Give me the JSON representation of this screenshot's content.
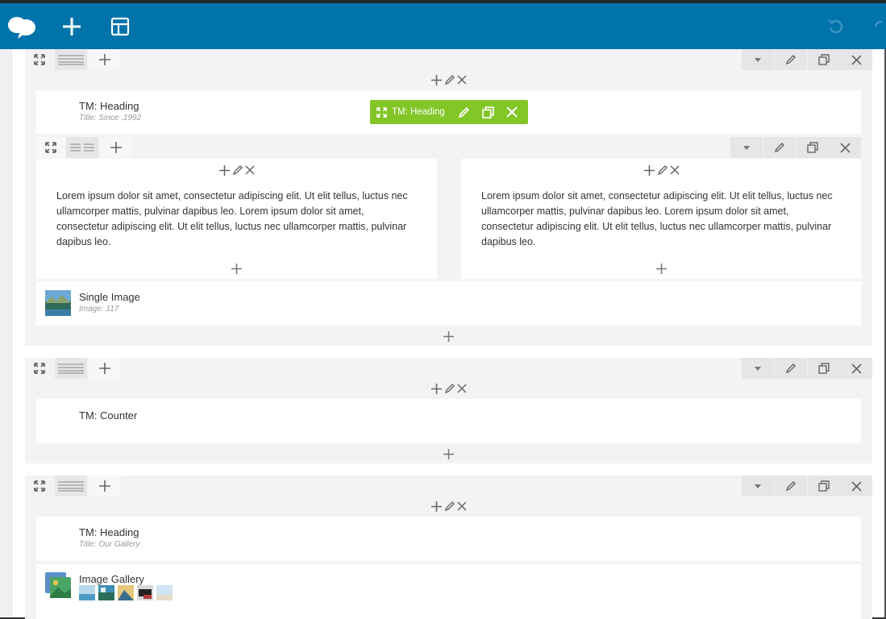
{
  "toolbar": {
    "icons": [
      "elementor-logo-icon",
      "add-element-icon",
      "templates-icon",
      "undo-icon",
      "redo-icon"
    ]
  },
  "rows": [
    {
      "widgets": [
        {
          "title": "TM: Heading",
          "subtitle": "Title: Since .1992"
        },
        {
          "title": "Single Image",
          "subtitle": "Image: 117"
        }
      ],
      "inner_columns": [
        {
          "text": "Lorem ipsum dolor sit amet, consectetur adipiscing elit. Ut elit tellus, luctus nec ullamcorper mattis, pulvinar dapibus leo. Lorem ipsum dolor sit amet, consectetur adipiscing elit. Ut elit tellus, luctus nec ullamcorper mattis, pulvinar dapibus leo."
        },
        {
          "text": "Lorem ipsum dolor sit amet, consectetur adipiscing elit. Ut elit tellus, luctus nec ullamcorper mattis, pulvinar dapibus leo. Lorem ipsum dolor sit amet, consectetur adipiscing elit. Ut elit tellus, luctus nec ullamcorper mattis, pulvinar dapibus leo."
        }
      ]
    },
    {
      "widgets": [
        {
          "title": "TM: Counter",
          "subtitle": ""
        }
      ]
    },
    {
      "widgets": [
        {
          "title": "TM: Heading",
          "subtitle": "Title: Our Gallery"
        },
        {
          "title": "Image Gallery",
          "subtitle": ""
        }
      ]
    }
  ],
  "tooltip": {
    "label": "TM: Heading"
  },
  "colors": {
    "topbar": "#0073aa",
    "tooltip": "#82c627",
    "row_bg": "#f3f3f3"
  }
}
